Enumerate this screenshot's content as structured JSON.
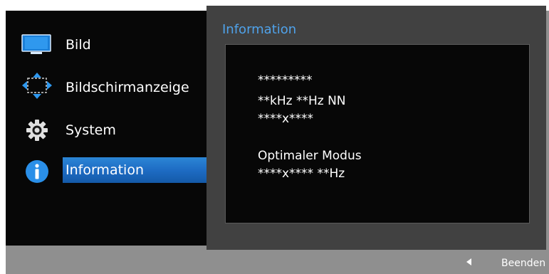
{
  "menu": {
    "items": [
      {
        "label": "Bild",
        "icon": "monitor-icon"
      },
      {
        "label": "Bildschirmanzeige",
        "icon": "move-arrows-icon"
      },
      {
        "label": "System",
        "icon": "gear-icon"
      },
      {
        "label": "Information",
        "icon": "info-icon",
        "selected": true
      }
    ]
  },
  "info": {
    "title": "Information",
    "lines": [
      "*********",
      "**kHz **Hz NN",
      "****x****",
      "Optimaler Modus",
      "****x**** **Hz"
    ]
  },
  "footer": {
    "back_icon": "triangle-left-icon",
    "exit_label": "Beenden"
  },
  "colors": {
    "accent": "#4fa2ea",
    "selection": "#1e6cc4",
    "panel": "#070707",
    "frame": "#8f8f8f"
  }
}
